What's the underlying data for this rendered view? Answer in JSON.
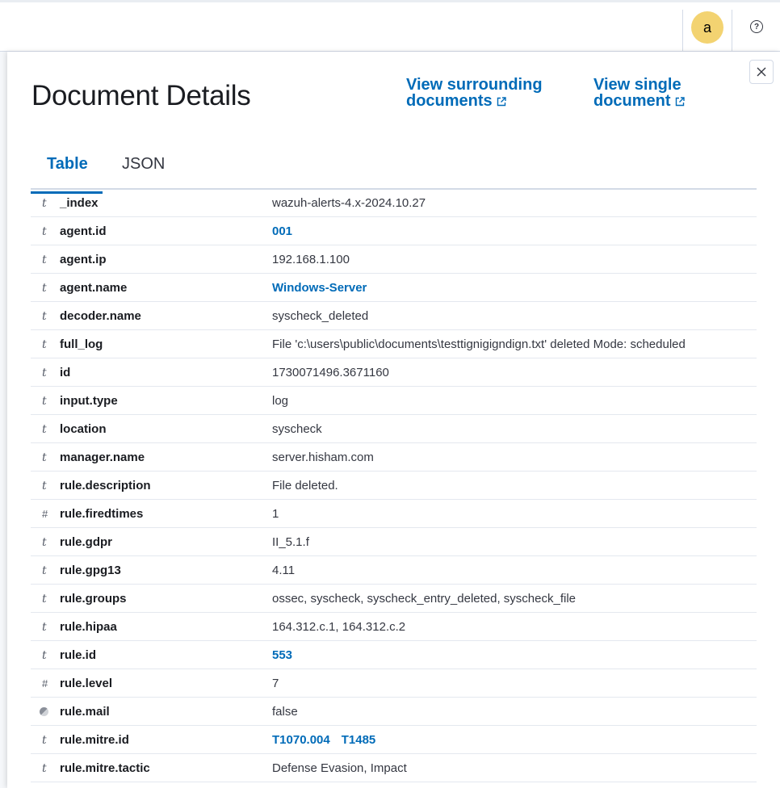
{
  "header": {
    "avatar_letter": "a",
    "help_icon": "?"
  },
  "flyout": {
    "title": "Document Details",
    "link_surrounding_line1": "View surrounding",
    "link_surrounding_line2": "documents",
    "link_single_line1": "View single",
    "link_single_line2": "document",
    "tabs": [
      {
        "label": "Table",
        "active": true
      },
      {
        "label": "JSON",
        "active": false
      }
    ]
  },
  "rows": [
    {
      "type": "t",
      "field": "_index",
      "value": "wazuh-alerts-4.x-2024.10.27",
      "link": false
    },
    {
      "type": "t",
      "field": "agent.id",
      "value": "001",
      "link": true
    },
    {
      "type": "t",
      "field": "agent.ip",
      "value": "192.168.1.100",
      "link": false
    },
    {
      "type": "t",
      "field": "agent.name",
      "value": "Windows-Server",
      "link": true
    },
    {
      "type": "t",
      "field": "decoder.name",
      "value": "syscheck_deleted",
      "link": false
    },
    {
      "type": "t",
      "field": "full_log",
      "value": "File 'c:\\users\\public\\documents\\testtignigigndign.txt' deleted Mode: scheduled",
      "link": false
    },
    {
      "type": "t",
      "field": "id",
      "value": "1730071496.3671160",
      "link": false
    },
    {
      "type": "t",
      "field": "input.type",
      "value": "log",
      "link": false
    },
    {
      "type": "t",
      "field": "location",
      "value": "syscheck",
      "link": false
    },
    {
      "type": "t",
      "field": "manager.name",
      "value": "server.hisham.com",
      "link": false
    },
    {
      "type": "t",
      "field": "rule.description",
      "value": "File deleted.",
      "link": false
    },
    {
      "type": "#",
      "field": "rule.firedtimes",
      "value": "1",
      "link": false
    },
    {
      "type": "t",
      "field": "rule.gdpr",
      "value": "II_5.1.f",
      "link": false
    },
    {
      "type": "t",
      "field": "rule.gpg13",
      "value": "4.11",
      "link": false
    },
    {
      "type": "t",
      "field": "rule.groups",
      "value": "ossec, syscheck, syscheck_entry_deleted, syscheck_file",
      "link": false
    },
    {
      "type": "t",
      "field": "rule.hipaa",
      "value": "164.312.c.1, 164.312.c.2",
      "link": false
    },
    {
      "type": "t",
      "field": "rule.id",
      "value": "553",
      "link": true
    },
    {
      "type": "#",
      "field": "rule.level",
      "value": "7",
      "link": false
    },
    {
      "type": "bool",
      "field": "rule.mail",
      "value": "false",
      "link": false
    },
    {
      "type": "t",
      "field": "rule.mitre.id",
      "value": "T1070.004",
      "value2": "T1485",
      "link": true
    },
    {
      "type": "t",
      "field": "rule.mitre.tactic",
      "value": "Defense Evasion, Impact",
      "link": false
    }
  ],
  "colors": {
    "accent": "#006bb8",
    "avatar": "#f3d371"
  }
}
